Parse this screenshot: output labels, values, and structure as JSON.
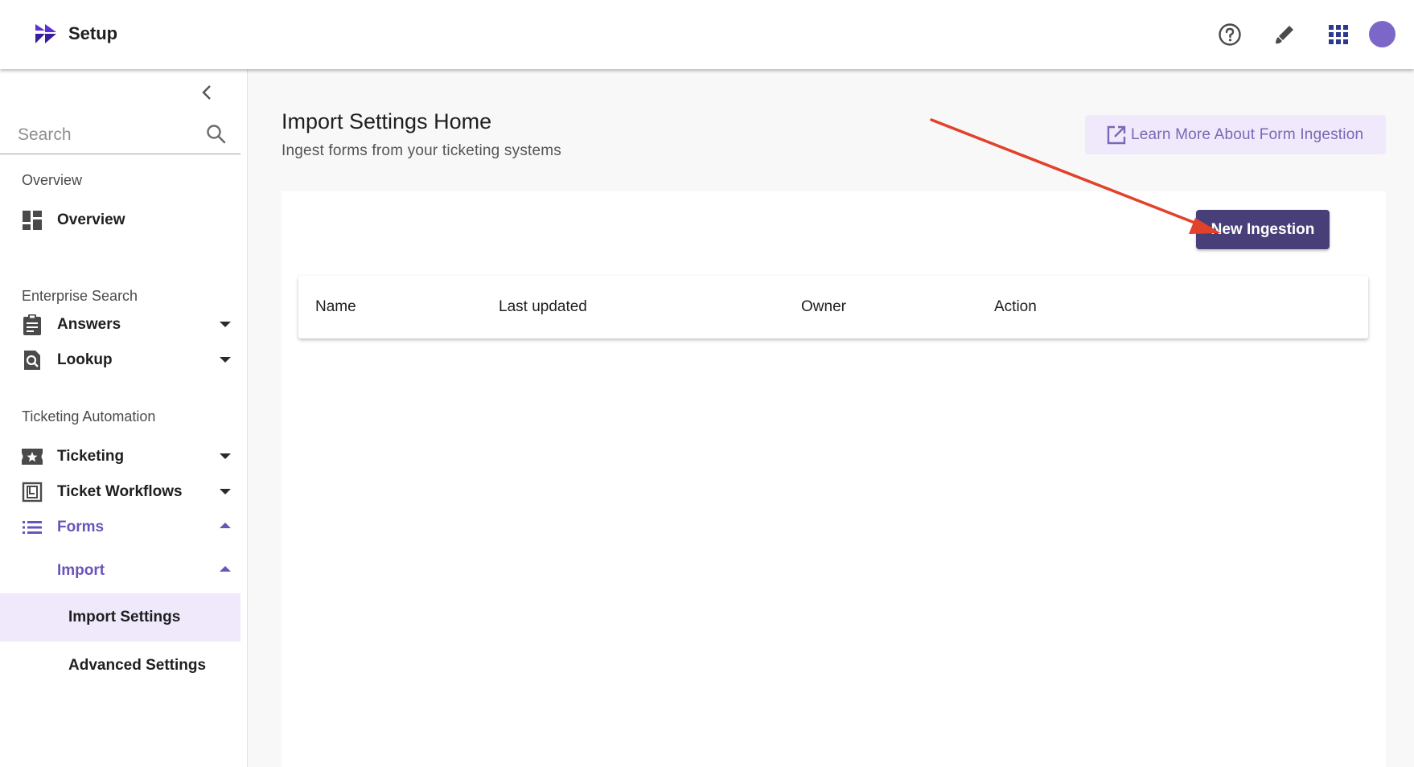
{
  "header": {
    "title": "Setup",
    "icons": [
      "help-icon",
      "brush-icon",
      "apps-grid-icon"
    ],
    "accent": "#7c66c7"
  },
  "sidebar": {
    "search_placeholder": "Search",
    "sections": {
      "overview": "Overview",
      "enterprise_search": "Enterprise Search",
      "ticketing_automation": "Ticketing Automation"
    },
    "items": {
      "overview": "Overview",
      "answers": "Answers",
      "lookup": "Lookup",
      "ticketing": "Ticketing",
      "ticket_workflows": "Ticket Workflows",
      "forms": "Forms",
      "import": "Import",
      "import_settings": "Import Settings",
      "advanced_settings": "Advanced Settings"
    },
    "active_color": "#6a54b8",
    "selected_bg": "#efe9fb"
  },
  "main": {
    "title": "Import Settings Home",
    "subtitle": "Ingest forms from your ticketing systems",
    "learn_more_label": "Learn More About Form Ingestion",
    "new_ingestion_label": "New Ingestion",
    "button_color": "#483e78",
    "table": {
      "columns": [
        "Name",
        "Last updated",
        "Owner",
        "Action"
      ],
      "rows": []
    }
  },
  "annotation": {
    "arrow_color": "#e2412b"
  }
}
